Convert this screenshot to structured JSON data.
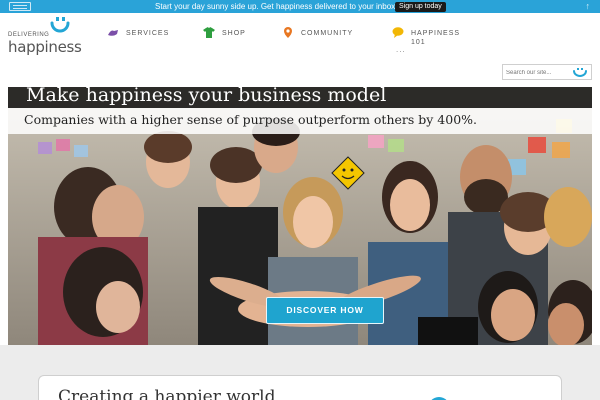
{
  "promo": {
    "message": "Start your day sunny side up. Get happiness delivered to your inbox!",
    "button_label": "Sign up today"
  },
  "header": {
    "logo_small": "DELIVERING",
    "logo_big": "happiness",
    "nav": [
      {
        "label": "Services",
        "icon": "hands-icon"
      },
      {
        "label": "Shop",
        "icon": "shirt-icon"
      },
      {
        "label": "Community",
        "icon": "map-pin-icon"
      },
      {
        "label": "Happiness",
        "label2": "101",
        "icon": "speech-bubble-icon"
      }
    ],
    "search_placeholder": "Search our site..."
  },
  "hero": {
    "title": "Make happiness your business model",
    "subtitle": "Companies with a higher sense of purpose outperform others by 400%.",
    "cta_label": "Discover How"
  },
  "section": {
    "title": "Creating a happier world"
  },
  "colors": {
    "brand_blue": "#2aa3d8",
    "cta_blue": "#1fa4cf",
    "nav_services": "#7b4fa8",
    "nav_shop": "#2e9e3f",
    "nav_community": "#e87722",
    "nav_happiness": "#f2b705"
  }
}
